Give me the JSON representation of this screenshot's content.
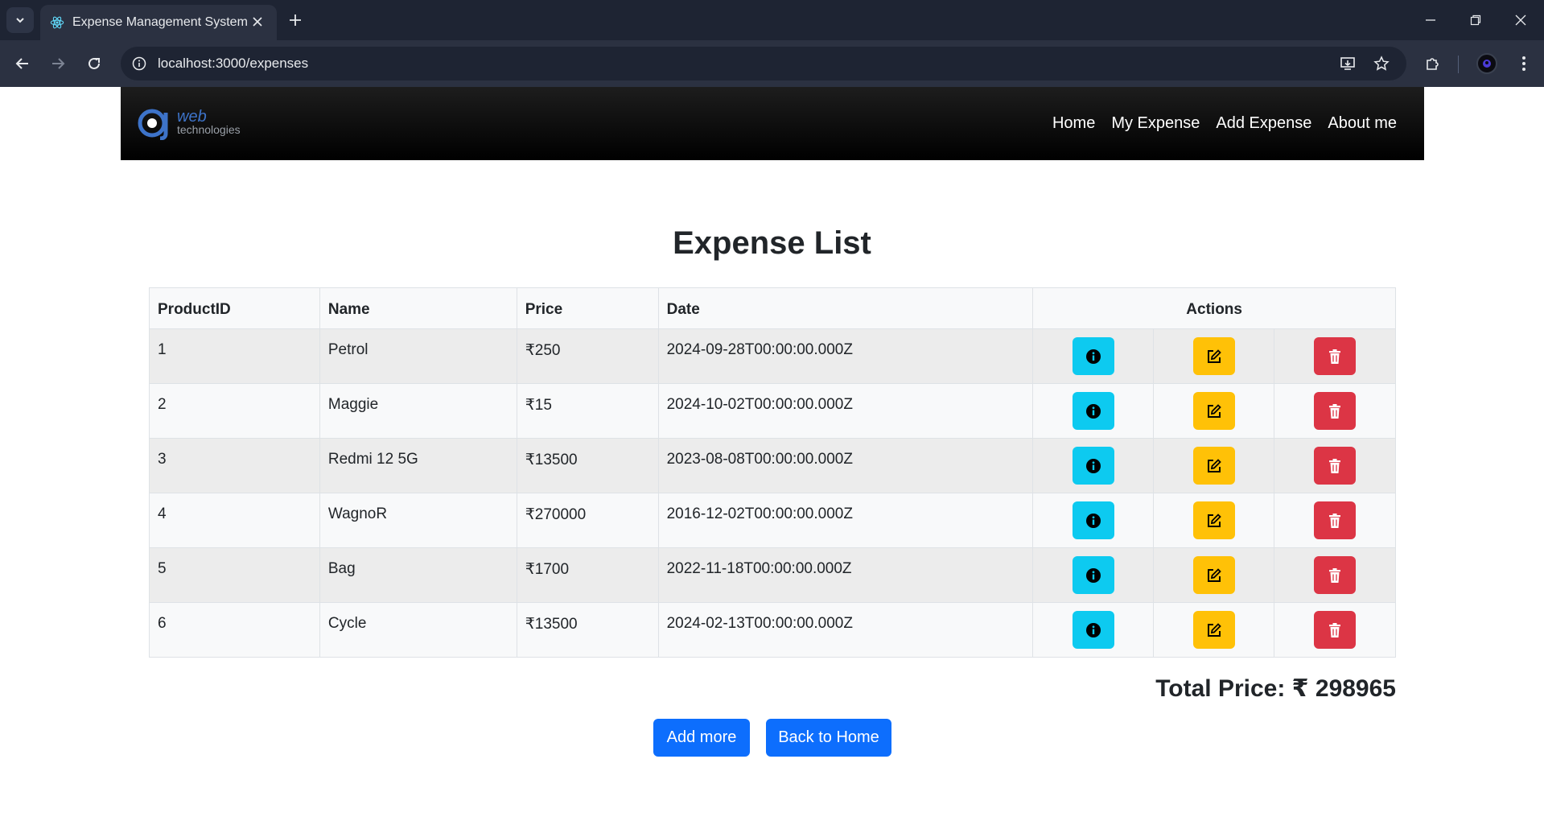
{
  "browser": {
    "tab_title": "Expense Management System",
    "url": "localhost:3000/expenses"
  },
  "navbar": {
    "logo_text_main": "web",
    "logo_text_sub": "technologies",
    "links": [
      "Home",
      "My Expense",
      "Add Expense",
      "About me"
    ]
  },
  "main": {
    "title": "Expense List",
    "table": {
      "headers": [
        "ProductID",
        "Name",
        "Price",
        "Date",
        "Actions"
      ],
      "rows": [
        {
          "id": "1",
          "name": "Petrol",
          "price": "₹250",
          "date": "2024-09-28T00:00:00.000Z"
        },
        {
          "id": "2",
          "name": "Maggie",
          "price": "₹15",
          "date": "2024-10-02T00:00:00.000Z"
        },
        {
          "id": "3",
          "name": "Redmi 12 5G",
          "price": "₹13500",
          "date": "2023-08-08T00:00:00.000Z"
        },
        {
          "id": "4",
          "name": "WagnoR",
          "price": "₹270000",
          "date": "2016-12-02T00:00:00.000Z"
        },
        {
          "id": "5",
          "name": "Bag",
          "price": "₹1700",
          "date": "2022-11-18T00:00:00.000Z"
        },
        {
          "id": "6",
          "name": "Cycle",
          "price": "₹13500",
          "date": "2024-02-13T00:00:00.000Z"
        }
      ]
    },
    "total_label": "Total Price: ₹ 298965",
    "add_more_label": "Add more",
    "back_home_label": "Back to Home"
  },
  "colors": {
    "info": "#0dcaf0",
    "edit": "#ffc107",
    "delete": "#dc3545",
    "primary": "#0d6efd"
  },
  "icons": [
    "dropdown-icon",
    "react-icon",
    "close-icon",
    "plus-icon",
    "minimize-icon",
    "restore-icon",
    "back-arrow-icon",
    "forward-arrow-icon",
    "reload-icon",
    "info-circle-icon",
    "install-icon",
    "star-icon",
    "extensions-icon",
    "more-icon",
    "edit-icon",
    "trash-icon"
  ]
}
